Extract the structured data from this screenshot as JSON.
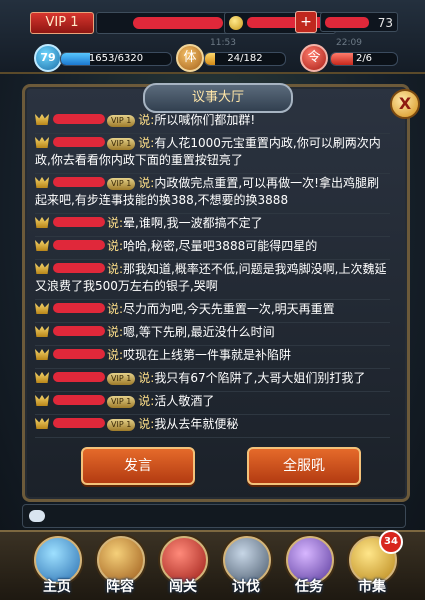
{
  "header": {
    "vip_label": "VIP 1",
    "level": "79",
    "exp": {
      "text": "1653/6320",
      "fraction": 0.26
    },
    "stamina": {
      "icon_char": "体",
      "text": "24/182",
      "fraction": 0.13,
      "timer": "11:53"
    },
    "token": {
      "icon_char": "令",
      "text": "2/6",
      "fraction": 0.33,
      "timer": "22:09"
    },
    "yuanbao_tail": "73",
    "gold_plus": "+"
  },
  "dialog": {
    "title": "议事大厅",
    "close_label": "X",
    "messages": [
      {
        "vip": "VIP 1",
        "shuo": "说:",
        "text": "所以喊你们都加群!"
      },
      {
        "vip": "VIP 1",
        "shuo": "说:",
        "text": "有人花1000元宝重置内政,你可以刷两次内政,你去看看你内政下面的重置按钮亮了"
      },
      {
        "vip": "VIP 1",
        "shuo": "说:",
        "text": "内政做完点重置,可以再做一次!拿出鸡腿刷起来吧,有步连事技能的换388,不想要的换3888"
      },
      {
        "vip": "",
        "shuo": "说:",
        "text": "晕,谁啊,我一波都搞不定了"
      },
      {
        "vip": "",
        "shuo": "说:",
        "text": "哈哈,秘密,尽量吧3888可能得四星的"
      },
      {
        "vip": "",
        "shuo": "说:",
        "text": "那我知道,概率还不低,问题是我鸡脚没啊,上次魏延又浪费了我500万左右的银子,哭啊"
      },
      {
        "vip": "",
        "shuo": "说:",
        "text": "尽力而为吧,今天先重置一次,明天再重置"
      },
      {
        "vip": "",
        "shuo": "说:",
        "text": "嗯,等下先刷,最近没什么时间"
      },
      {
        "vip": "",
        "shuo": "说:",
        "text": "哎现在上线第一件事就是补陷阱"
      },
      {
        "vip": "VIP 1",
        "shuo": "说:",
        "text": "我只有67个陷阱了,大哥大姐们别打我了"
      },
      {
        "vip": "VIP 1",
        "shuo": "说:",
        "text": "活人敬酒了"
      },
      {
        "vip": "VIP 1",
        "shuo": "说:",
        "text": "我从去年就便秘"
      }
    ],
    "send_button": "发言",
    "world_button": "全服吼"
  },
  "nav": {
    "items": [
      {
        "label": "主页",
        "icon": "home-icon"
      },
      {
        "label": "阵容",
        "icon": "formation-icon"
      },
      {
        "label": "闯关",
        "icon": "campaign-icon"
      },
      {
        "label": "讨伐",
        "icon": "crusade-icon"
      },
      {
        "label": "任务",
        "icon": "quest-icon"
      },
      {
        "label": "市集",
        "icon": "market-icon",
        "badge": "34"
      }
    ]
  },
  "colors": {
    "accent_gold": "#ffe08a",
    "button_orange": "#d2511d",
    "redaction": "#e0283a"
  }
}
